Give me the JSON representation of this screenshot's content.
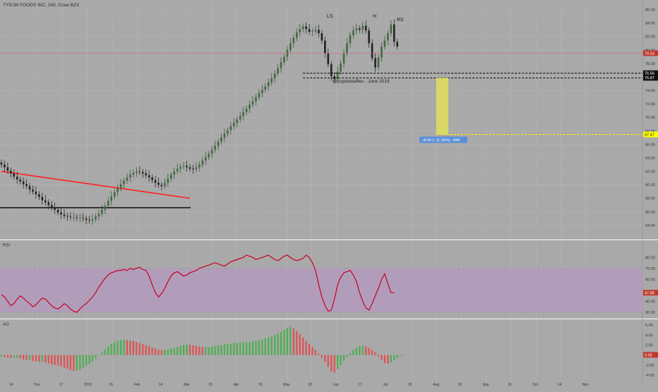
{
  "header": {
    "title": "TYSON FOODS INC, 240, Cboe BZX"
  },
  "annotation": {
    "credit": "@cryptowaffles - June 2019"
  },
  "colors": {
    "background": "#a9a9a9",
    "grid": "#b4b4b4",
    "up_candle": "#2f4f2f",
    "down_candle": "#1a1a1a",
    "trendline": "#ff2020",
    "support": "#000000",
    "price_line": "#d46a6a",
    "target_box": "#e2e05a",
    "target_line": "#ffff00",
    "measure_label": "#5a8fd6",
    "rsi_line": "#c8001e",
    "rsi_band": "#b49ac0",
    "ao_up": "#4caf50",
    "ao_down": "#e05050"
  },
  "chart_data": [
    {
      "type": "candlestick",
      "title": "TYSON FOODS INC, 240, Cboe BZX",
      "ylim": [
        52.0,
        87.0
      ],
      "y_ticks": [
        "86.00",
        "84.00",
        "82.00",
        "80.00",
        "78.00",
        "76.00",
        "74.00",
        "72.00",
        "70.00",
        "68.00",
        "66.00",
        "64.00",
        "62.00",
        "60.00",
        "58.00",
        "56.00",
        "54.00"
      ],
      "x_ticks": [
        "14",
        "Dec",
        "17",
        "2019",
        "15",
        "Feb",
        "14",
        "Mar",
        "15",
        "Apr",
        "15",
        "May",
        "20",
        "Jun",
        "17",
        "Jul",
        "15",
        "Aug",
        "19",
        "Sep",
        "16",
        "Oct",
        "14",
        "Nov"
      ],
      "price_closes": [
        63,
        62.6,
        62.1,
        61.7,
        61.2,
        60.8,
        60.5,
        60.1,
        59.8,
        59.3,
        59.0,
        58.6,
        58.2,
        57.7,
        57.4,
        57.0,
        56.6,
        56.3,
        55.9,
        55.6,
        55.4,
        55.3,
        55.2,
        55.2,
        55.1,
        55.1,
        55.0,
        54.8,
        54.7,
        54.9,
        55.3,
        55.7,
        56.3,
        56.9,
        57.6,
        58.3,
        58.9,
        59.5,
        60.1,
        60.6,
        61.1,
        61.5,
        61.8,
        62.0,
        61.9,
        61.7,
        61.4,
        61.1,
        60.7,
        60.3,
        60.0,
        59.8,
        60.3,
        60.9,
        61.5,
        62.0,
        62.4,
        62.7,
        62.8,
        62.6,
        62.4,
        62.3,
        62.6,
        63.0,
        63.6,
        64.1,
        64.6,
        65.2,
        65.8,
        66.4,
        67.0,
        67.6,
        68.1,
        68.7,
        69.2,
        69.7,
        70.2,
        70.8,
        71.3,
        71.9,
        72.4,
        73.0,
        73.6,
        74.1,
        74.6,
        75.2,
        75.8,
        76.5,
        77.3,
        78.2,
        79.0,
        80.0,
        81.0,
        81.8,
        82.6,
        83.1,
        83.5,
        83.1,
        82.7,
        82.8,
        83.0,
        82.5,
        81.4,
        79.5,
        77.9,
        76.1,
        75.7,
        76.8,
        78.0,
        79.5,
        81.0,
        82.2,
        82.9,
        83.2,
        83.0,
        83.6,
        82.9,
        81.0,
        78.8,
        77.4,
        78.9,
        80.5,
        81.4,
        82.5,
        83.8,
        81.2,
        80.5
      ],
      "levels": [
        {
          "name": "current-price",
          "value": 79.53,
          "label": "79.53"
        },
        {
          "name": "neckline-upper",
          "value": 76.56,
          "label": "76.56"
        },
        {
          "name": "neckline-lower",
          "value": 75.87,
          "label": "75.87"
        },
        {
          "name": "target",
          "value": 67.47,
          "label": "67.47"
        }
      ],
      "pattern_labels": [
        "LS",
        "H",
        "RS"
      ],
      "measure_label": "−8.40 (−11.06%) −840",
      "trendline": {
        "from": [
          0,
          62.0
        ],
        "to": [
          126,
          58.0
        ]
      },
      "support_line": {
        "value": 56.6
      },
      "projection_box": {
        "top": 75.87,
        "bottom": 67.47
      }
    },
    {
      "type": "line",
      "title": "RSI",
      "ylim": [
        25,
        95
      ],
      "y_ticks": [
        "80.00",
        "70.00",
        "60.00",
        "40.00",
        "30.00"
      ],
      "band": [
        30,
        70
      ],
      "last_label": "47.88",
      "values": [
        46,
        44,
        40,
        36,
        38,
        42,
        45,
        43,
        40,
        38,
        35,
        37,
        40,
        43,
        42,
        39,
        36,
        34,
        33,
        35,
        38,
        36,
        33,
        31,
        30,
        33,
        36,
        38,
        41,
        44,
        48,
        53,
        57,
        61,
        64,
        66,
        67,
        68,
        68,
        69,
        68,
        70,
        69,
        70,
        71,
        69,
        68,
        63,
        55,
        48,
        44,
        47,
        52,
        58,
        63,
        66,
        67,
        65,
        63,
        64,
        66,
        67,
        68,
        70,
        71,
        72,
        73,
        74,
        75,
        74,
        73,
        72,
        74,
        76,
        77,
        78,
        79,
        80,
        82,
        81,
        80,
        78,
        79,
        80,
        81,
        82,
        80,
        78,
        77,
        79,
        81,
        82,
        80,
        78,
        77,
        78,
        79,
        82,
        80,
        75,
        68,
        55,
        44,
        36,
        31,
        32,
        42,
        55,
        62,
        66,
        67,
        68,
        64,
        58,
        48,
        40,
        34,
        32,
        38,
        45,
        52,
        60,
        65,
        56,
        48,
        47.88
      ]
    },
    {
      "type": "bar",
      "title": "AO",
      "ylim": [
        -5,
        7
      ],
      "y_ticks": [
        "6.00",
        "4.00",
        "2.00",
        "-2.00",
        "-4.00"
      ],
      "last_label": "0.03",
      "values": [
        -0.3,
        -0.4,
        -0.5,
        -0.6,
        -0.6,
        -0.5,
        -0.7,
        -0.9,
        -1.0,
        -1.0,
        -1.2,
        -1.3,
        -1.4,
        -1.3,
        -1.5,
        -1.7,
        -1.9,
        -2.0,
        -2.1,
        -2.3,
        -2.5,
        -2.7,
        -3.0,
        -3.2,
        -3.1,
        -2.9,
        -2.6,
        -2.2,
        -1.8,
        -1.3,
        -0.7,
        -0.1,
        0.5,
        1.1,
        1.7,
        2.2,
        2.6,
        2.9,
        3.0,
        3.1,
        3.0,
        2.9,
        2.8,
        2.6,
        2.4,
        2.2,
        2.0,
        1.8,
        1.5,
        1.3,
        1.1,
        1.0,
        1.0,
        1.1,
        1.3,
        1.4,
        1.6,
        1.8,
        2.0,
        2.1,
        2.0,
        1.9,
        1.8,
        1.7,
        1.6,
        1.6,
        1.6,
        1.7,
        1.8,
        1.9,
        2.0,
        2.1,
        2.2,
        2.3,
        2.4,
        2.4,
        2.5,
        2.5,
        2.6,
        2.6,
        2.7,
        2.8,
        2.9,
        3.1,
        3.3,
        3.5,
        3.7,
        4.0,
        4.3,
        4.7,
        5.0,
        5.4,
        5.6,
        5.3,
        4.8,
        4.2,
        3.5,
        2.8,
        2.2,
        1.6,
        1.0,
        0.3,
        -0.5,
        -1.4,
        -2.4,
        -3.3,
        -3.5,
        -2.8,
        -2.0,
        -1.2,
        -0.4,
        0.3,
        1.0,
        1.5,
        1.8,
        1.9,
        1.7,
        1.4,
        1.0,
        0.5,
        -0.3,
        -1.0,
        -1.6,
        -1.8,
        -1.5,
        -1.0,
        -0.6,
        -0.2,
        0.03
      ]
    }
  ]
}
